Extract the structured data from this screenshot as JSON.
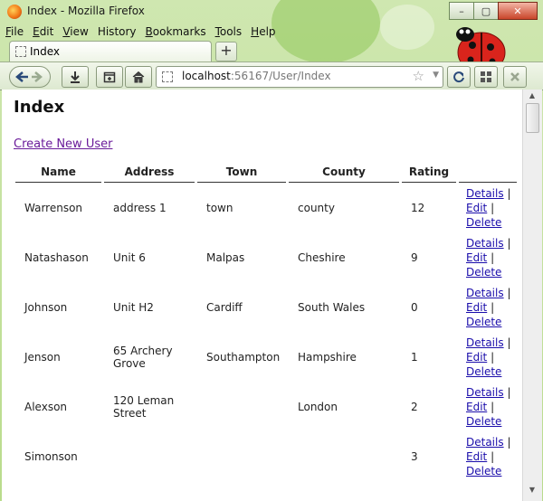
{
  "window": {
    "title": "Index - Mozilla Firefox",
    "controls": [
      "–",
      "▢",
      "✕"
    ]
  },
  "menu": [
    {
      "label": "File",
      "accel": "F",
      "rest": "ile"
    },
    {
      "label": "Edit",
      "accel": "E",
      "rest": "dit"
    },
    {
      "label": "View",
      "accel": "V",
      "rest": "iew"
    },
    {
      "label": "History",
      "accel": "",
      "rest": "History"
    },
    {
      "label": "Bookmarks",
      "accel": "B",
      "rest": "ookmarks"
    },
    {
      "label": "Tools",
      "accel": "T",
      "rest": "ools"
    },
    {
      "label": "Help",
      "accel": "H",
      "rest": "elp"
    }
  ],
  "tab": {
    "label": "Index",
    "new_tab": "+"
  },
  "nav": {
    "url_host": "localhost",
    "url_rest": ":56167/User/Index",
    "star": "☆",
    "dropdown": "▼"
  },
  "page": {
    "title": "Index",
    "create_link": "Create New User",
    "columns": [
      "Name",
      "Address",
      "Town",
      "County",
      "Rating",
      ""
    ],
    "rows": [
      {
        "name": "Warrenson",
        "address": "address 1",
        "town": "town",
        "county": "county",
        "rating": "12"
      },
      {
        "name": "Natashason",
        "address": "Unit 6",
        "town": "Malpas",
        "county": "Cheshire",
        "rating": "9"
      },
      {
        "name": "Johnson",
        "address": "Unit H2",
        "town": "Cardiff",
        "county": "South Wales",
        "rating": "0"
      },
      {
        "name": "Jenson",
        "address": "65 Archery Grove",
        "town": "Southampton",
        "county": "Hampshire",
        "rating": "1"
      },
      {
        "name": "Alexson",
        "address": "120 Leman Street",
        "town": "",
        "county": "London",
        "rating": "2"
      },
      {
        "name": "Simonson",
        "address": "",
        "town": "",
        "county": "",
        "rating": "3"
      }
    ],
    "actions": {
      "details": "Details",
      "edit": "Edit",
      "delete": "Delete",
      "sep": "|"
    }
  },
  "colors": {
    "link_visited": "#6a1b9a",
    "link": "#1a0dab",
    "chrome_green": "#b9dc8c"
  }
}
